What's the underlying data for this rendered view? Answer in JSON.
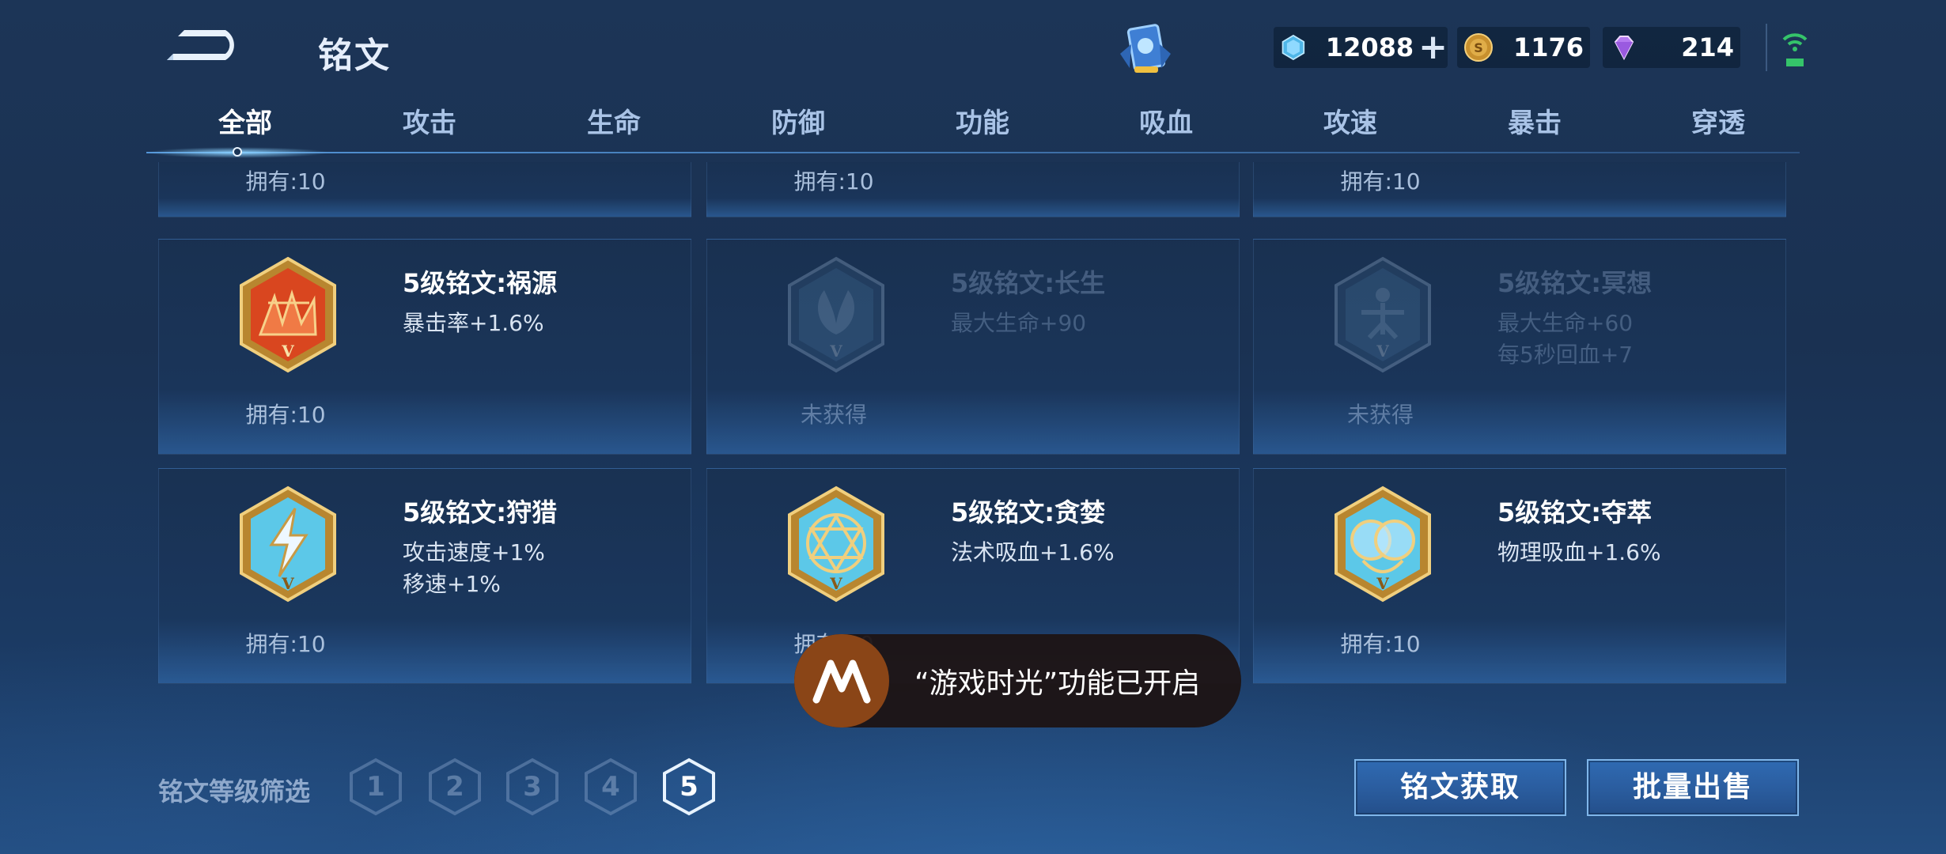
{
  "header": {
    "title": "铭文",
    "currencies": [
      {
        "icon": "crystal-icon",
        "value": "12088"
      },
      {
        "icon": "gold-coin-icon",
        "value": "1176"
      },
      {
        "icon": "purple-gem-icon",
        "value": "214"
      }
    ]
  },
  "tabs": [
    "全部",
    "攻击",
    "生命",
    "防御",
    "功能",
    "吸血",
    "攻速",
    "暴击",
    "穿透"
  ],
  "active_tab": "全部",
  "cards": [
    {
      "name": "",
      "attrs": [],
      "owned": "拥有:10"
    },
    {
      "name": "",
      "attrs": [],
      "owned": "拥有:10"
    },
    {
      "name": "",
      "attrs": [],
      "owned": "拥有:10"
    },
    {
      "name": "5级铭文:祸源",
      "attrs": [
        "暴击率+1.6%"
      ],
      "owned": "拥有:10",
      "locked": false,
      "emblem_color": "#d9461f"
    },
    {
      "name": "5级铭文:长生",
      "attrs": [
        "最大生命+90"
      ],
      "owned": "未获得",
      "locked": true,
      "emblem_color": "#5b8db8"
    },
    {
      "name": "5级铭文:冥想",
      "attrs": [
        "最大生命+60",
        "每5秒回血+7"
      ],
      "owned": "未获得",
      "locked": true,
      "emblem_color": "#5b8db8"
    },
    {
      "name": "5级铭文:狩猎",
      "attrs": [
        "攻击速度+1%",
        "移速+1%"
      ],
      "owned": "拥有:10",
      "locked": false,
      "emblem_color": "#5cc8e8"
    },
    {
      "name": "5级铭文:贪婪",
      "attrs": [
        "法术吸血+1.6%"
      ],
      "owned": "拥有:10",
      "locked": false,
      "emblem_color": "#5cc8e8"
    },
    {
      "name": "5级铭文:夺萃",
      "attrs": [
        "物理吸血+1.6%"
      ],
      "owned": "拥有:10",
      "locked": false,
      "emblem_color": "#5cc8e8"
    }
  ],
  "toast": {
    "text": "“游戏时光”功能已开启"
  },
  "filter": {
    "label": "铭文等级筛选",
    "levels": [
      "1",
      "2",
      "3",
      "4",
      "5"
    ],
    "active_level": "5"
  },
  "buttons": {
    "get": "铭文获取",
    "sell": "批量出售"
  }
}
